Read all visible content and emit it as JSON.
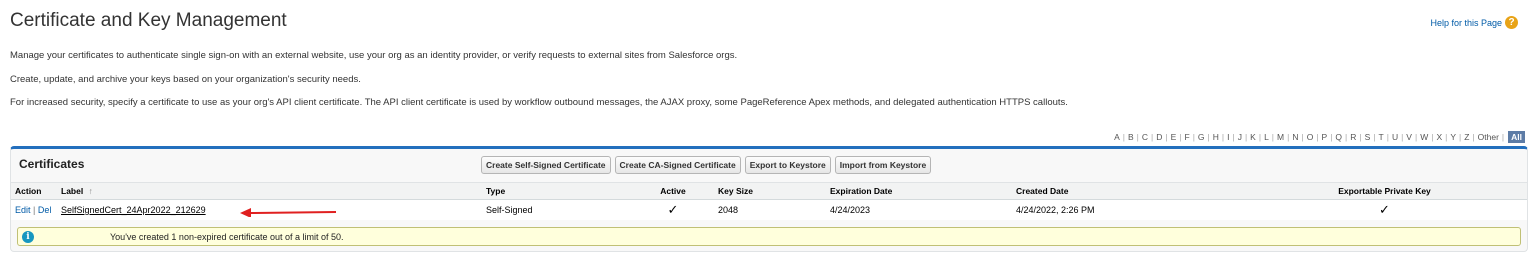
{
  "page": {
    "title": "Certificate and Key Management",
    "help_link": "Help for this Page",
    "help_icon": "?",
    "descriptions": [
      "Manage your certificates to authenticate single sign-on with an external website, use your org as an identity provider, or verify requests to external sites from Salesforce orgs.",
      "Create, update, and archive your keys based on your organization's security needs.",
      "For increased security, specify a certificate to use as your org's API client certificate. The API client certificate is used by workflow outbound messages, the AJAX proxy, some PageReference Apex methods, and delegated authentication HTTPS callouts."
    ]
  },
  "alpha_filter": [
    "A",
    "B",
    "C",
    "D",
    "E",
    "F",
    "G",
    "H",
    "I",
    "J",
    "K",
    "L",
    "M",
    "N",
    "O",
    "P",
    "Q",
    "R",
    "S",
    "T",
    "U",
    "V",
    "W",
    "X",
    "Y",
    "Z",
    "Other",
    "All"
  ],
  "certificates": {
    "title": "Certificates",
    "buttons": {
      "self_signed": "Create Self-Signed Certificate",
      "ca_signed": "Create CA-Signed Certificate",
      "export": "Export to Keystore",
      "import": "Import from Keystore"
    },
    "columns": {
      "action": "Action",
      "label": "Label",
      "sort_indicator": "↑",
      "type": "Type",
      "active": "Active",
      "key_size": "Key Size",
      "expiration": "Expiration Date",
      "created": "Created Date",
      "exportable": "Exportable Private Key"
    },
    "rows": [
      {
        "edit": "Edit",
        "separator": "|",
        "del": "Del",
        "label": "SelfSignedCert_24Apr2022_212629",
        "type": "Self-Signed",
        "active": "✓",
        "key_size": "2048",
        "expiration": "4/24/2023",
        "created": "4/24/2022, 2:26 PM",
        "exportable": "✓"
      }
    ],
    "info_icon": "i",
    "info_message": "You've created 1 non-expired certificate out of a limit of 50."
  },
  "colors": {
    "accent": "#236fbd",
    "link": "#015ba7",
    "annotation_arrow": "#e02020",
    "info_background": "#ffffdc"
  }
}
